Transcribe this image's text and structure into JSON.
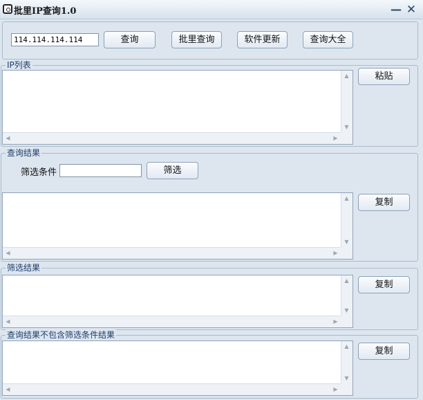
{
  "window": {
    "title": "批里IP查询1.0",
    "minimize_glyph": "—",
    "close_glyph": "✕",
    "icon": "app-icon"
  },
  "toolbar": {
    "ip_input_value": "114.114.114.114",
    "query_label": "查询",
    "batch_query_label": "批里查询",
    "software_update_label": "软件更新",
    "query_all_label": "查询大全"
  },
  "ip_list": {
    "legend": "IP列表",
    "paste_label": "粘贴",
    "content": ""
  },
  "query_results": {
    "legend": "查询结果",
    "filter_condition_label": "筛选条件",
    "filter_input_value": "",
    "filter_button_label": "筛选",
    "copy_label": "复制",
    "content": ""
  },
  "filter_results": {
    "legend": "筛选结果",
    "copy_label": "复制",
    "content": ""
  },
  "excluded_results": {
    "legend": "查询结果不包含筛选条件结果",
    "copy_label": "复制",
    "content": ""
  },
  "scrollbar": {
    "up": "▲",
    "down": "▼",
    "left": "◀",
    "right": "▶"
  }
}
